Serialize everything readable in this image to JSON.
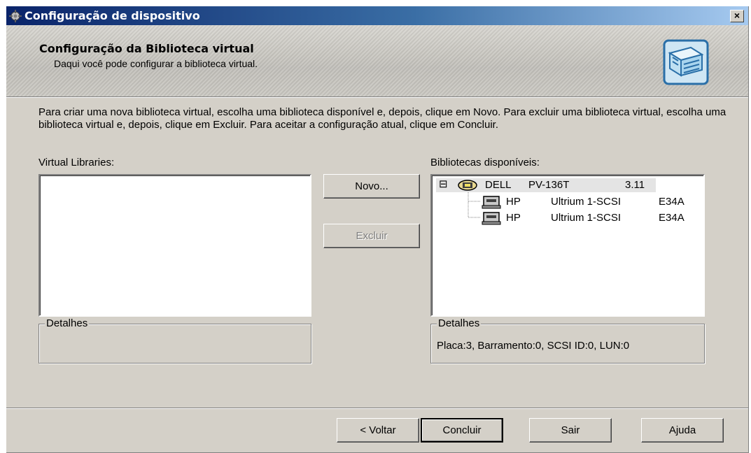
{
  "window": {
    "title": "Configuração de dispositivo",
    "close_label": "×"
  },
  "banner": {
    "title": "Configuração da Biblioteca virtual",
    "subtitle": "Daqui você pode configurar a biblioteca virtual."
  },
  "instructions": "Para criar uma nova biblioteca virtual, escolha uma biblioteca disponível e, depois, clique em Novo. Para excluir uma biblioteca virtual, escolha uma biblioteca virtual e, depois, clique em Excluir. Para aceitar a configuração atual, clique em Concluir.",
  "virtual_libraries": {
    "label": "Virtual Libraries:",
    "items": [],
    "details_legend": "Detalhes",
    "details_text": ""
  },
  "actions": {
    "new_label": "Novo...",
    "delete_label": "Excluir"
  },
  "available_libraries": {
    "label": "Bibliotecas disponíveis:",
    "tree": {
      "expander": "⊟",
      "root": {
        "vendor": "DELL",
        "model": "PV-136T",
        "version": "3.11",
        "icon": "tape-library-icon"
      },
      "children": [
        {
          "vendor": "HP",
          "model": "Ultrium 1-SCSI",
          "version": "E34A",
          "icon": "tape-drive-icon"
        },
        {
          "vendor": "HP",
          "model": "Ultrium 1-SCSI",
          "version": "E34A",
          "icon": "tape-drive-icon"
        }
      ]
    },
    "details_legend": "Detalhes",
    "details_text": "Placa:3, Barramento:0, SCSI ID:0, LUN:0"
  },
  "footer": {
    "back_label": "< Voltar",
    "finish_label": "Concluir",
    "exit_label": "Sair",
    "help_label": "Ajuda"
  }
}
